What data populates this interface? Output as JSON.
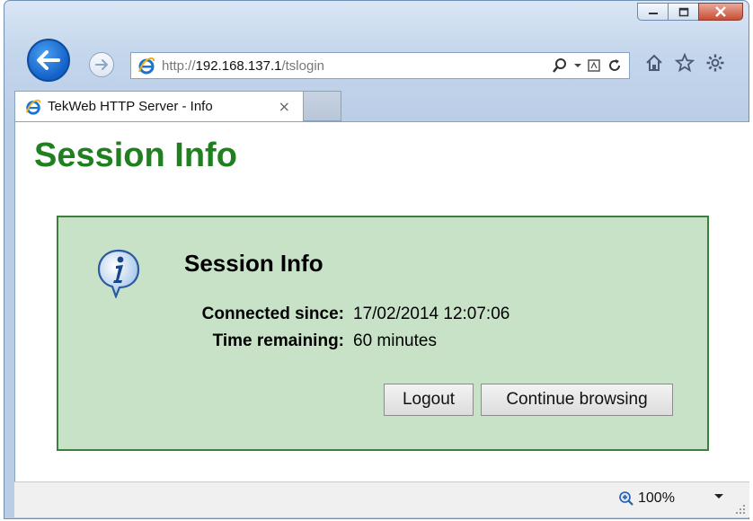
{
  "window": {
    "controls": [
      "minimize",
      "maximize",
      "close"
    ]
  },
  "nav": {
    "back": "back-arrow-icon",
    "forward": "forward-arrow-icon"
  },
  "address_bar": {
    "url_prefix": "http://",
    "url_host": "192.168.137.1",
    "url_path": "/tslogin",
    "tools": [
      "search-icon",
      "dropdown-icon",
      "compatibility-icon",
      "refresh-icon"
    ]
  },
  "toolbar_icons": [
    "home-icon",
    "favorites-star-icon",
    "settings-gear-icon"
  ],
  "tab": {
    "title": "TekWeb HTTP Server - Info",
    "close": "×"
  },
  "page": {
    "heading": "Session Info",
    "panel": {
      "title": "Session Info",
      "icon": "info-icon",
      "rows": [
        {
          "label": "Connected since:",
          "value": "17/02/2014 12:07:06"
        },
        {
          "label": "Time remaining:",
          "value": "60 minutes"
        }
      ],
      "buttons": {
        "logout": "Logout",
        "continue": "Continue browsing"
      }
    }
  },
  "status_bar": {
    "zoom": "100%"
  },
  "colors": {
    "heading_green": "#208020",
    "panel_bg": "#c8e2c8",
    "panel_border": "#3e7e3e",
    "back_button_blue": "#1260c8",
    "close_red": "#c84d35"
  }
}
